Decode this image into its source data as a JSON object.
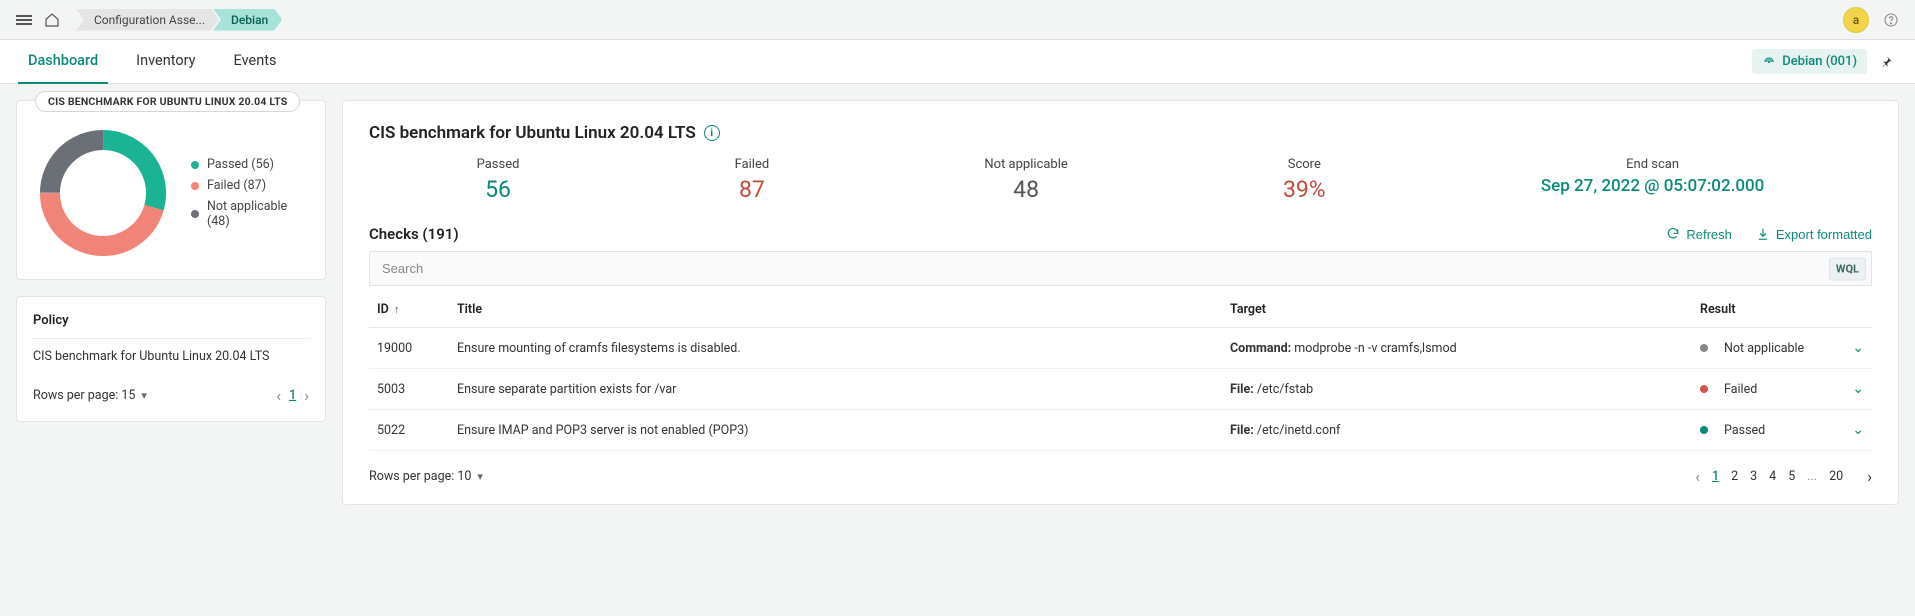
{
  "breadcrumbs": [
    {
      "label": "Configuration Asse..."
    },
    {
      "label": "Debian"
    }
  ],
  "avatar_letter": "a",
  "tabs": [
    {
      "label": "Dashboard"
    },
    {
      "label": "Inventory"
    },
    {
      "label": "Events"
    }
  ],
  "agent_chip": "Debian (001)",
  "donut": {
    "title": "CIS BENCHMARK FOR UBUNTU LINUX 20.04 LTS",
    "legend": {
      "passed": "Passed (56)",
      "failed": "Failed (87)",
      "na": "Not applicable (48)"
    }
  },
  "policy": {
    "heading": "Policy",
    "name": "CIS benchmark for Ubuntu Linux 20.04 LTS",
    "rows_label": "Rows per page: 15",
    "page_current": "1"
  },
  "benchmark": {
    "title": "CIS benchmark for Ubuntu Linux 20.04 LTS",
    "stats": {
      "passed_label": "Passed",
      "passed_value": "56",
      "failed_label": "Failed",
      "failed_value": "87",
      "na_label": "Not applicable",
      "na_value": "48",
      "score_label": "Score",
      "score_value": "39%",
      "endscan_label": "End scan",
      "endscan_value": "Sep 27, 2022 @ 05:07:02.000"
    }
  },
  "checks": {
    "heading": "Checks (191)",
    "refresh": "Refresh",
    "export": "Export formatted",
    "search_placeholder": "Search",
    "wql": "WQL",
    "columns": {
      "id": "ID",
      "title": "Title",
      "target": "Target",
      "result": "Result"
    },
    "rows": [
      {
        "id": "19000",
        "title": "Ensure mounting of cramfs filesystems is disabled.",
        "target_type": "Command:",
        "target_value": "modprobe -n -v cramfs,lsmod",
        "result": "Not applicable",
        "result_kind": "na"
      },
      {
        "id": "5003",
        "title": "Ensure separate partition exists for /var",
        "target_type": "File:",
        "target_value": "/etc/fstab",
        "result": "Failed",
        "result_kind": "failed"
      },
      {
        "id": "5022",
        "title": "Ensure IMAP and POP3 server is not enabled (POP3)",
        "target_type": "File:",
        "target_value": "/etc/inetd.conf",
        "result": "Passed",
        "result_kind": "passed"
      }
    ],
    "footer": {
      "rows_label": "Rows per page: 10",
      "pages": [
        "1",
        "2",
        "3",
        "4",
        "5",
        "...",
        "20"
      ]
    }
  },
  "chart_data": {
    "type": "pie",
    "title": "CIS BENCHMARK FOR UBUNTU LINUX 20.04 LTS",
    "series": [
      {
        "name": "Passed",
        "value": 56,
        "color": "#1ab394"
      },
      {
        "name": "Failed",
        "value": 87,
        "color": "#f08479"
      },
      {
        "name": "Not applicable",
        "value": 48,
        "color": "#6b6f76"
      }
    ]
  }
}
